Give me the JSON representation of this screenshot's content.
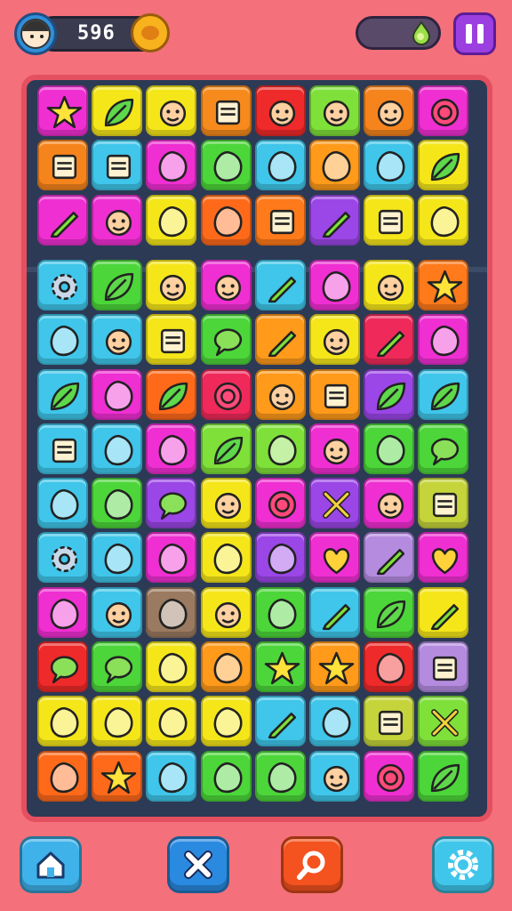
{
  "hud": {
    "score": "596",
    "avatar_icon": "boy-face-icon",
    "coin_icon": "coin-icon",
    "energy_icon": "energy-drop-icon",
    "pause_icon": "pause-icon"
  },
  "colors": {
    "background": "#f4707a",
    "board": "#2c3a55",
    "board_border": "#e45060",
    "tile_palette": [
      "#ef2fd2",
      "#f5e61a",
      "#b660ea",
      "#f68a1c",
      "#ef2a2a",
      "#7fe03a",
      "#3fc6ea",
      "#4cd63a",
      "#ff9a1a",
      "#c4d43a"
    ]
  },
  "board": {
    "columns": 8,
    "rows": 13,
    "tiles": [
      {
        "color": "#ef2fd2",
        "icon": "star-icon"
      },
      {
        "color": "#f5e61a",
        "icon": "leaf-icon"
      },
      {
        "color": "#f5e61a",
        "icon": "monster-icon"
      },
      {
        "color": "#f68a1c",
        "icon": "cube-icon"
      },
      {
        "color": "#ef2a2a",
        "icon": "smiley-icon"
      },
      {
        "color": "#7fe03a",
        "icon": "doll-face-icon"
      },
      {
        "color": "#f6841c",
        "icon": "chef-face-icon"
      },
      {
        "color": "#ef2fd2",
        "icon": "ring-icon"
      },
      {
        "color": "#f6841c",
        "icon": "flag-icon"
      },
      {
        "color": "#3fc6ea",
        "icon": "grid-icon"
      },
      {
        "color": "#ef2fd2",
        "icon": "diamond-icon"
      },
      {
        "color": "#4cd63a",
        "icon": "bird-icon"
      },
      {
        "color": "#3fc6ea",
        "icon": "jellyfish-icon"
      },
      {
        "color": "#ff9a1a",
        "icon": "wheel-icon"
      },
      {
        "color": "#3fc6ea",
        "icon": "candy-icon"
      },
      {
        "color": "#f5e61a",
        "icon": "feather-icon"
      },
      {
        "color": "#ef2fd2",
        "icon": "pin-icon"
      },
      {
        "color": "#ef2fd2",
        "icon": "hat-face-icon"
      },
      {
        "color": "#f5e61a",
        "icon": "hand-icon"
      },
      {
        "color": "#ff6a1a",
        "icon": "pumpkin-icon"
      },
      {
        "color": "#ff7a1a",
        "icon": "note-icon"
      },
      {
        "color": "#9b46e6",
        "icon": "pencil-icon"
      },
      {
        "color": "#f5e61a",
        "icon": "robot-icon"
      },
      {
        "color": "#f5e61a",
        "icon": "swirl-icon"
      },
      {
        "color": "#3fc6ea",
        "icon": "gear-icon"
      },
      {
        "color": "#4cd63a",
        "icon": "leaf-icon"
      },
      {
        "color": "#f5e61a",
        "icon": "girl-face-icon"
      },
      {
        "color": "#ef2fd2",
        "icon": "smiley-icon"
      },
      {
        "color": "#3fc6ea",
        "icon": "wrench-icon"
      },
      {
        "color": "#ef2fd2",
        "icon": "banana-icon"
      },
      {
        "color": "#f5e61a",
        "icon": "chef-face-icon"
      },
      {
        "color": "#ff7a1a",
        "icon": "star-icon"
      },
      {
        "color": "#3fc6ea",
        "icon": "splat-icon"
      },
      {
        "color": "#3fc6ea",
        "icon": "cap-face-icon"
      },
      {
        "color": "#f5e61a",
        "icon": "fridge-icon"
      },
      {
        "color": "#4cd63a",
        "icon": "bubble-icon"
      },
      {
        "color": "#ff9a1a",
        "icon": "pepper-icon"
      },
      {
        "color": "#f5e61a",
        "icon": "alien-icon"
      },
      {
        "color": "#ef2a5a",
        "icon": "sword-icon"
      },
      {
        "color": "#ef2fd2",
        "icon": "splat-icon"
      },
      {
        "color": "#3fc6ea",
        "icon": "plant-icon"
      },
      {
        "color": "#ef2fd2",
        "icon": "swirl-icon"
      },
      {
        "color": "#ff6a1a",
        "icon": "feather-icon"
      },
      {
        "color": "#ef2a5a",
        "icon": "target-icon"
      },
      {
        "color": "#ff9a1a",
        "icon": "frog-icon"
      },
      {
        "color": "#ff9a1a",
        "icon": "bag-icon"
      },
      {
        "color": "#9b46e6",
        "icon": "plant-icon"
      },
      {
        "color": "#3fc6ea",
        "icon": "pickle-icon"
      },
      {
        "color": "#3fc6ea",
        "icon": "tv-icon"
      },
      {
        "color": "#3fc6ea",
        "icon": "sun-icon"
      },
      {
        "color": "#ef2fd2",
        "icon": "diamond-icon"
      },
      {
        "color": "#7fe03a",
        "icon": "leaf-icon"
      },
      {
        "color": "#7fe03a",
        "icon": "cup-icon"
      },
      {
        "color": "#ef2fd2",
        "icon": "doll-face-icon"
      },
      {
        "color": "#4cd63a",
        "icon": "bug-icon"
      },
      {
        "color": "#4cd63a",
        "icon": "bubble-icon"
      },
      {
        "color": "#3fc6ea",
        "icon": "bell-icon"
      },
      {
        "color": "#4cd63a",
        "icon": "fish-icon"
      },
      {
        "color": "#9b46e6",
        "icon": "cloud-icon"
      },
      {
        "color": "#f5e61a",
        "icon": "shield-face-icon"
      },
      {
        "color": "#ef2fd2",
        "icon": "ring-icon"
      },
      {
        "color": "#9b46e6",
        "icon": "cross-icon"
      },
      {
        "color": "#ef2fd2",
        "icon": "cap-face-icon"
      },
      {
        "color": "#c4d43a",
        "icon": "box-icon"
      },
      {
        "color": "#3fc6ea",
        "icon": "gear-icon"
      },
      {
        "color": "#3fc6ea",
        "icon": "glasses-icon"
      },
      {
        "color": "#ef2fd2",
        "icon": "arrow-icon"
      },
      {
        "color": "#f5e61a",
        "icon": "candy-icon"
      },
      {
        "color": "#9b46e6",
        "icon": "bone-icon"
      },
      {
        "color": "#ef2fd2",
        "icon": "heart-icon"
      },
      {
        "color": "#b58be0",
        "icon": "wrench-icon"
      },
      {
        "color": "#ef2fd2",
        "icon": "heart-icon"
      },
      {
        "color": "#ef2fd2",
        "icon": "bookmark-icon"
      },
      {
        "color": "#3fc6ea",
        "icon": "bear-icon"
      },
      {
        "color": "#9a7a60",
        "icon": "balloon-icon"
      },
      {
        "color": "#f5e61a",
        "icon": "hat-face-icon"
      },
      {
        "color": "#4cd63a",
        "icon": "fox-icon"
      },
      {
        "color": "#3fc6ea",
        "icon": "pencil-icon"
      },
      {
        "color": "#4cd63a",
        "icon": "maple-leaf-icon"
      },
      {
        "color": "#f5e61a",
        "icon": "rocket-icon"
      },
      {
        "color": "#ef2a2a",
        "icon": "speech-bubble-icon"
      },
      {
        "color": "#4cd63a",
        "icon": "bubble-icon"
      },
      {
        "color": "#f5e61a",
        "icon": "bottle-icon"
      },
      {
        "color": "#ff9a1a",
        "icon": "pie-icon"
      },
      {
        "color": "#4cd63a",
        "icon": "star-icon"
      },
      {
        "color": "#ff9a1a",
        "icon": "star-icon"
      },
      {
        "color": "#ef2a2a",
        "icon": "gem-icon"
      },
      {
        "color": "#b58be0",
        "icon": "jar-icon"
      },
      {
        "color": "#f5e61a",
        "icon": "drop-icon"
      },
      {
        "color": "#f5e61a",
        "icon": "mask-icon"
      },
      {
        "color": "#f5e61a",
        "icon": "lollipop-icon"
      },
      {
        "color": "#f5e61a",
        "icon": "pentagon-icon"
      },
      {
        "color": "#3fc6ea",
        "icon": "pin-icon"
      },
      {
        "color": "#3fc6ea",
        "icon": "tag-icon"
      },
      {
        "color": "#c4d43a",
        "icon": "clipboard-icon"
      },
      {
        "color": "#7fe03a",
        "icon": "cross-icon"
      },
      {
        "color": "#ff6a1a",
        "icon": "tag-icon"
      },
      {
        "color": "#ff6a1a",
        "icon": "star-icon"
      },
      {
        "color": "#3fc6ea",
        "icon": "blob-icon"
      },
      {
        "color": "#4cd63a",
        "icon": "flame-icon"
      },
      {
        "color": "#4cd63a",
        "icon": "blob-icon"
      },
      {
        "color": "#3fc6ea",
        "icon": "ghost-icon"
      },
      {
        "color": "#ef2fd2",
        "icon": "ring-icon"
      },
      {
        "color": "#4cd63a",
        "icon": "leaf-icon"
      }
    ]
  },
  "bottom_bar": [
    {
      "name": "home-button",
      "icon": "home-icon",
      "color": "#3fb2ea"
    },
    {
      "name": "shuffle-button",
      "icon": "close-icon",
      "color": "#2a8ae0"
    },
    {
      "name": "search-button",
      "icon": "magnifier-icon",
      "color": "#f4521e"
    },
    {
      "name": "settings-button",
      "icon": "gear-icon",
      "color": "#3fc6ea"
    }
  ]
}
